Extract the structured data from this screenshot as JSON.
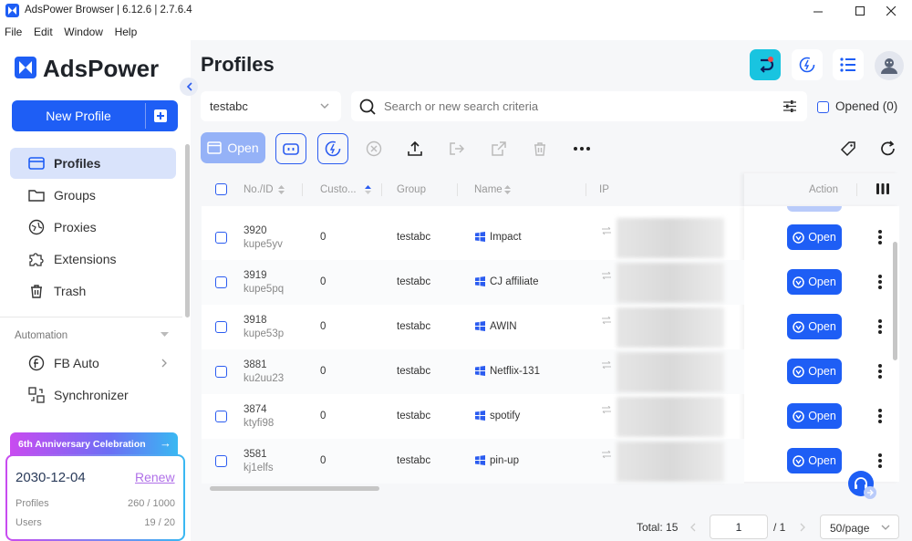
{
  "window": {
    "title": "AdsPower Browser | 6.12.6 | 2.7.6.4"
  },
  "menu": [
    "File",
    "Edit",
    "Window",
    "Help"
  ],
  "brand": {
    "name": "AdsPower"
  },
  "sidebar": {
    "new_profile_label": "New Profile",
    "items": [
      {
        "label": "Profiles",
        "icon": "profiles-icon"
      },
      {
        "label": "Groups",
        "icon": "folder-icon"
      },
      {
        "label": "Proxies",
        "icon": "proxy-icon"
      },
      {
        "label": "Extensions",
        "icon": "puzzle-icon"
      },
      {
        "label": "Trash",
        "icon": "trash-icon"
      }
    ],
    "automation_label": "Automation",
    "automation_items": [
      {
        "label": "FB Auto",
        "icon": "fb-auto-icon"
      },
      {
        "label": "Synchronizer",
        "icon": "synchronizer-icon"
      }
    ],
    "promo": {
      "banner": "6th Anniversary Celebration",
      "date": "2030-12-04",
      "renew": "Renew",
      "profiles_label": "Profiles",
      "profiles_value": "260 / 1000",
      "users_label": "Users",
      "users_value": "19 / 20"
    }
  },
  "header": {
    "title": "Profiles"
  },
  "filters": {
    "group_value": "testabc",
    "search_placeholder": "Search or new search criteria",
    "opened_label": "Opened (0)"
  },
  "toolbar": {
    "open_label": "Open"
  },
  "table": {
    "columns": {
      "no_id": "No./ID",
      "custom": "Custo...",
      "group": "Group",
      "name": "Name",
      "ip": "IP",
      "action": "Action"
    },
    "rows": [
      {
        "no": "3920",
        "id": "kupe5yv",
        "custom": "0",
        "group": "testabc",
        "name": "Impact",
        "action": "Open"
      },
      {
        "no": "3919",
        "id": "kupe5pq",
        "custom": "0",
        "group": "testabc",
        "name": "CJ affiliate",
        "action": "Open"
      },
      {
        "no": "3918",
        "id": "kupe53p",
        "custom": "0",
        "group": "testabc",
        "name": "AWIN",
        "action": "Open"
      },
      {
        "no": "3881",
        "id": "ku2uu23",
        "custom": "0",
        "group": "testabc",
        "name": "Netflix-131",
        "action": "Open"
      },
      {
        "no": "3874",
        "id": "ktyfi98",
        "custom": "0",
        "group": "testabc",
        "name": "spotify",
        "action": "Open"
      },
      {
        "no": "3581",
        "id": "kj1elfs",
        "custom": "0",
        "group": "testabc",
        "name": "pin-up",
        "action": "Open"
      }
    ]
  },
  "pagination": {
    "total": "Total: 15",
    "page": "1",
    "of": "/ 1",
    "per_page": "50/page"
  },
  "colors": {
    "accent": "#1e5ef5",
    "active_nav": "#d9e3fb"
  }
}
